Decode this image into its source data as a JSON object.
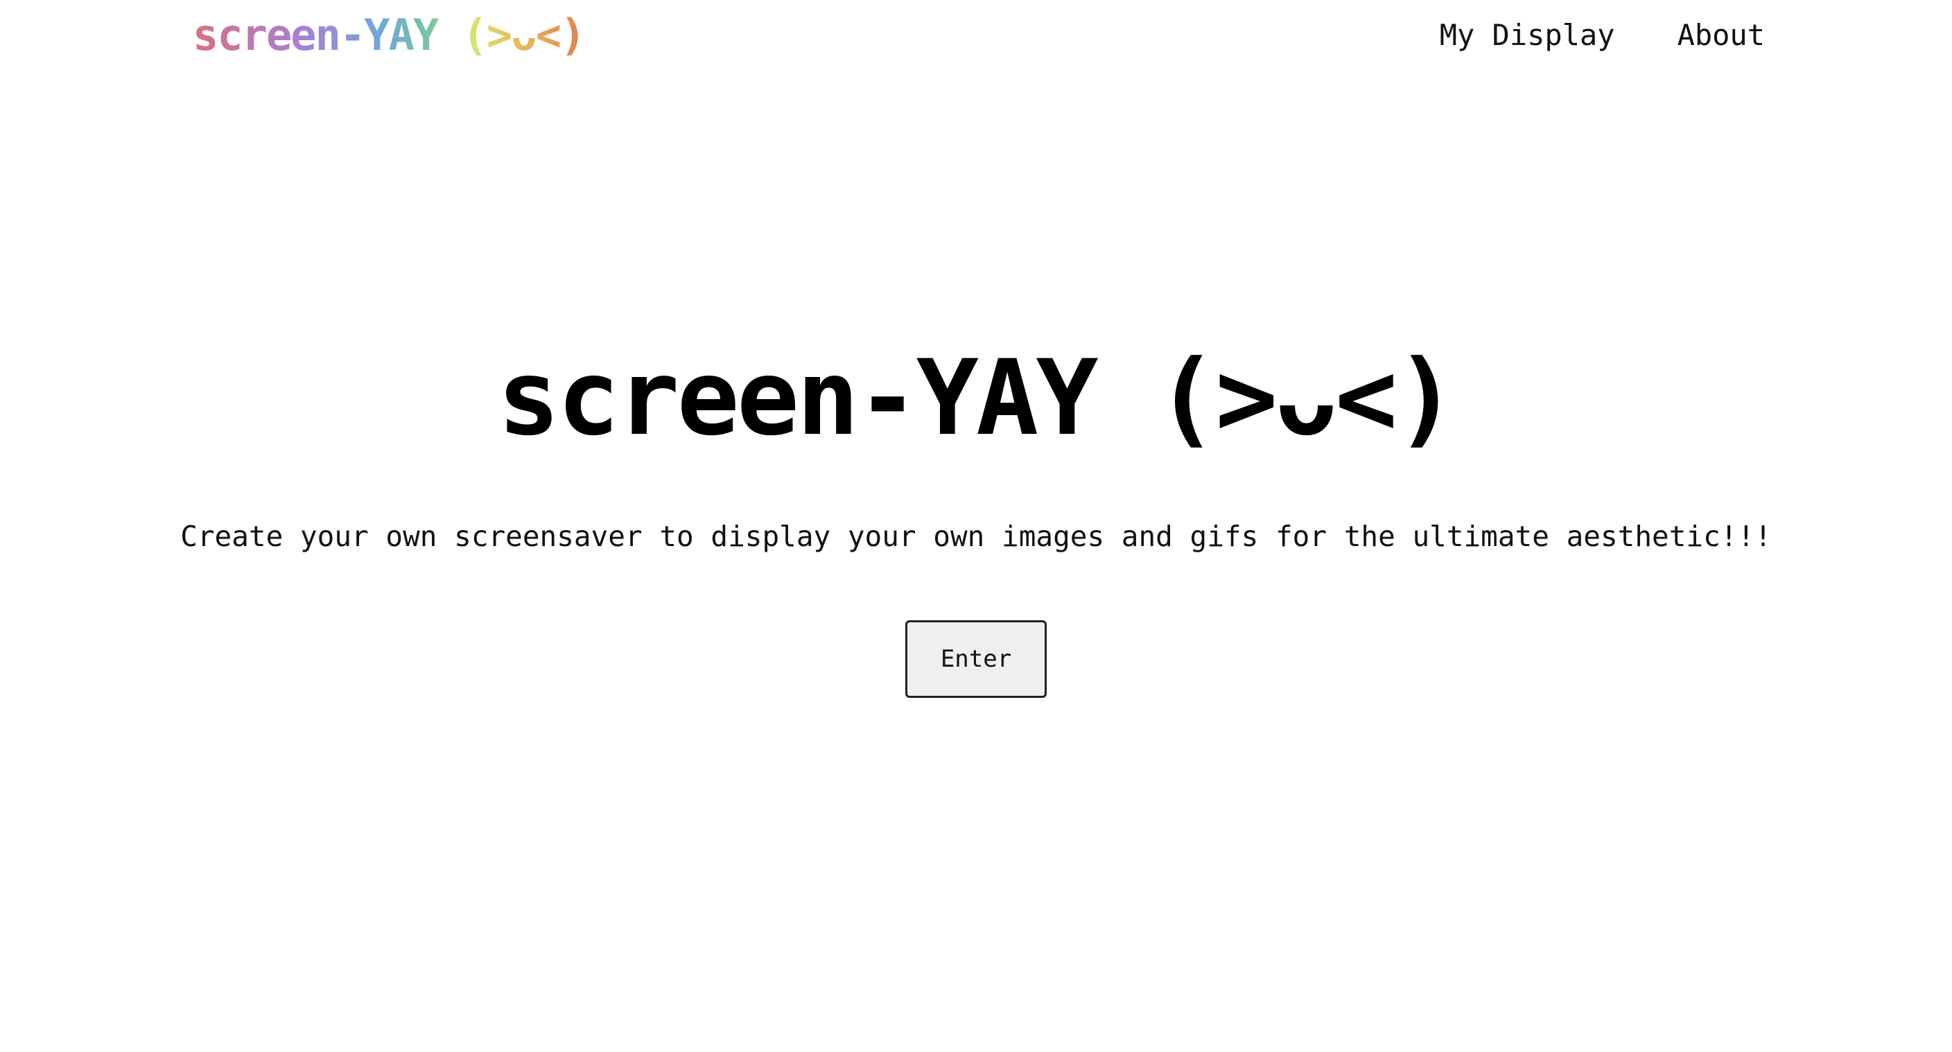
{
  "navbar": {
    "brand": "screen-YAY (>ᴗ<)",
    "brand_colors": [
      "#d9707c",
      "#a77fd6",
      "#6fa8d8",
      "#79c2a6",
      "#d8e36d",
      "#e7b45a",
      "#de7f4e"
    ],
    "links": [
      {
        "label": "My Display"
      },
      {
        "label": "About"
      }
    ]
  },
  "hero": {
    "title": "screen-YAY (>ᴗ<)",
    "subtitle": "Create your own screensaver to display your own images and gifs for the ultimate aesthetic!!!",
    "button_label": "Enter"
  }
}
